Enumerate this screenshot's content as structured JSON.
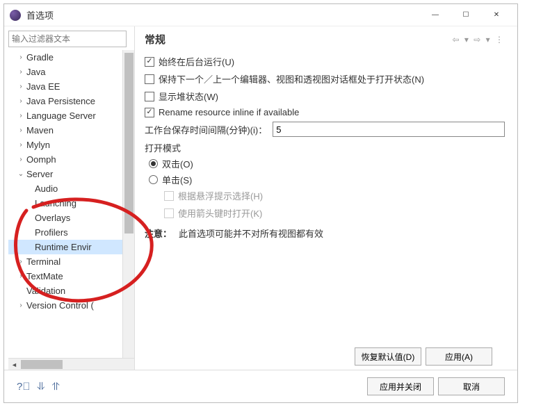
{
  "window": {
    "title": "首选项",
    "min": "—",
    "max": "☐",
    "close": "✕"
  },
  "sidebar": {
    "filter_placeholder": "输入过滤器文本",
    "items": [
      {
        "label": "Gradle",
        "expandable": true
      },
      {
        "label": "Java",
        "expandable": true
      },
      {
        "label": "Java EE",
        "expandable": true
      },
      {
        "label": "Java Persistence",
        "expandable": true
      },
      {
        "label": "Language Server",
        "expandable": true
      },
      {
        "label": "Maven",
        "expandable": true
      },
      {
        "label": "Mylyn",
        "expandable": true
      },
      {
        "label": "Oomph",
        "expandable": true
      },
      {
        "label": "Server",
        "expandable": true,
        "expanded": true,
        "children": [
          {
            "label": "Audio"
          },
          {
            "label": "Launching"
          },
          {
            "label": "Overlays"
          },
          {
            "label": "Profilers"
          },
          {
            "label": "Runtime Envir",
            "selected": true
          }
        ]
      },
      {
        "label": "Terminal",
        "expandable": true
      },
      {
        "label": "TextMate",
        "expandable": true
      },
      {
        "label": "Validation"
      },
      {
        "label": "Version Control (",
        "expandable": true
      }
    ]
  },
  "content": {
    "heading": "常规",
    "nav": "⇦ ▾ ⇨ ▾ ⋮",
    "chk_background": "始终在后台运行(U)",
    "chk_keep_editor": "保持下一个／上一个编辑器、视图和透视图对话框处于打开状态(N)",
    "chk_show_heap": "显示堆状态(W)",
    "chk_rename_inline": "Rename resource inline if available",
    "save_interval_label": "工作台保存时间间隔(分钟)(i)：",
    "save_interval_value": "5",
    "open_mode_title": "打开模式",
    "radio_double": "双击(O)",
    "radio_single": "单击(S)",
    "sub_hover": "根据悬浮提示选择(H)",
    "sub_arrow": "使用箭头键时打开(K)",
    "note_label": "注意：",
    "note_text": "此首选项可能并不对所有视图都有效"
  },
  "buttons": {
    "restore": "恢复默认值(D)",
    "apply": "应用(A)",
    "apply_close": "应用并关闭",
    "cancel": "取消"
  }
}
